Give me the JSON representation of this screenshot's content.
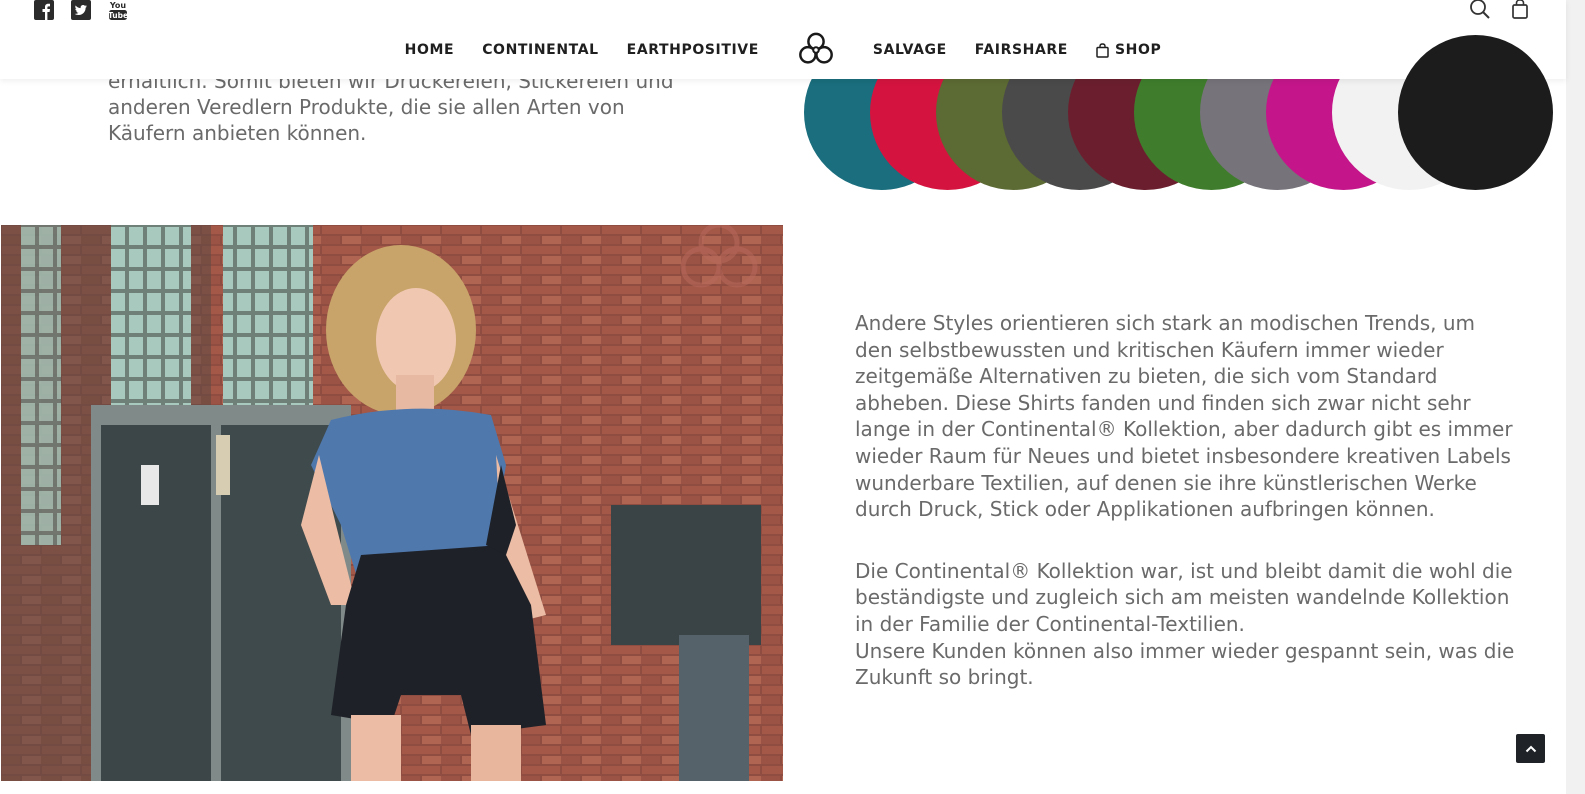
{
  "header": {
    "social": [
      {
        "name": "facebook-icon"
      },
      {
        "name": "twitter-icon"
      },
      {
        "name": "youtube-icon"
      }
    ],
    "nav": [
      {
        "label": "HOME"
      },
      {
        "label": "CONTINENTAL"
      },
      {
        "label": "EARTHPOSITIVE"
      },
      {
        "label": "SALVAGE"
      },
      {
        "label": "FAIRSHARE"
      },
      {
        "label": "SHOP"
      }
    ],
    "logo_icon": "biohazard-logo-icon",
    "tools": [
      "search-icon",
      "shopping-bag-icon"
    ]
  },
  "intro": {
    "lines": [
      "erhältlich. Somit bieten wir Druckereien, Stickereien und",
      "anderen Veredlern Produkte, die sie allen Arten von",
      "Käufern anbieten können."
    ]
  },
  "swatches": {
    "colors": [
      "#1a6e7d",
      "#d4143f",
      "#5c6a33",
      "#4a4a4a",
      "#6b1f2e",
      "#3f7d2c",
      "#76737a",
      "#c4168a",
      "#f2f2f2",
      "#1c1c1c"
    ]
  },
  "content": {
    "paragraphs": [
      "Andere Styles orientieren sich stark an modischen Trends, um den selbstbewussten und kritischen Käufern immer wieder zeitgemäße Alternativen zu bieten, die sich vom Standard abheben. Diese Shirts fanden und finden sich zwar nicht sehr lange in der Continental® Kollektion, aber dadurch gibt es immer wieder Raum für Neues und bietet insbesondere kreativen Labels wunderbare Textilien, auf denen sie ihre künstlerischen Werke durch Druck, Stick oder Applikationen aufbringen können.",
      "Die Continental® Kollektion war, ist und bleibt damit die wohl die beständigste und zugleich sich am meisten wandelnde Kollektion in der Familie der Continental-Textilien.",
      "Unsere Kunden können also immer wieder gespannt sein, was die Zukunft so bringt."
    ]
  },
  "scroll_top_icon": "chevron-up-icon"
}
